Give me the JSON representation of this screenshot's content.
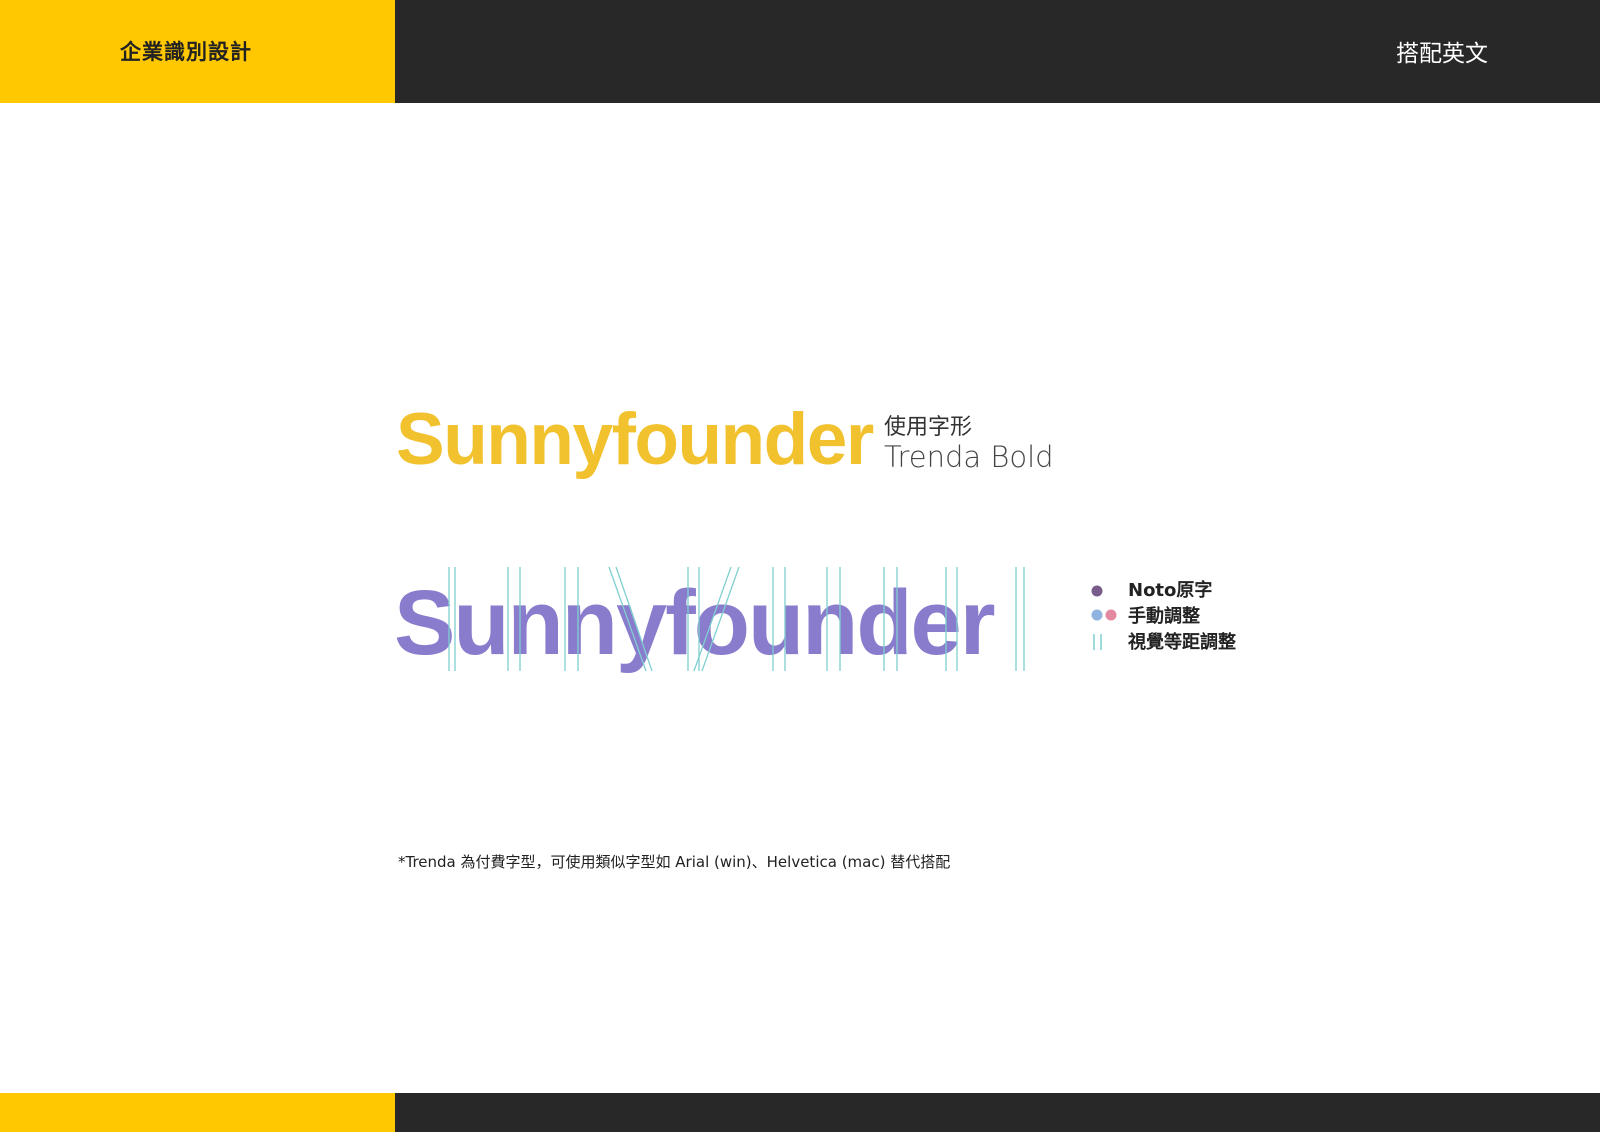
{
  "header": {
    "section_title": "企業識別設計",
    "page_heading": "搭配英文"
  },
  "colors": {
    "brand_yellow": "#FFC800",
    "dark": "#282828",
    "wordmark_yellow": "#F2C12E",
    "wordmark_purple": "#8A7CCC",
    "guide_line": "#7FCFD0",
    "legend_dot_purple": "#7A5C8C",
    "legend_dot_blue": "#8FB4E0",
    "legend_dot_pink": "#E48AA0"
  },
  "wordmark": {
    "text": "Sunnyfounder"
  },
  "font_info": {
    "label": "使用字形",
    "name": "Trenda Bold"
  },
  "legend": {
    "items": [
      {
        "icon": "dot-purple-icon",
        "label": "Noto原字"
      },
      {
        "icon": "dots-blue-pink-icon",
        "label": "手動調整"
      },
      {
        "icon": "double-line-icon",
        "label": "視覺等距調整"
      }
    ]
  },
  "footnote": "*Trenda 為付費字型，可使用類似字型如 Arial (win)、Helvetica (mac) 替代搭配"
}
